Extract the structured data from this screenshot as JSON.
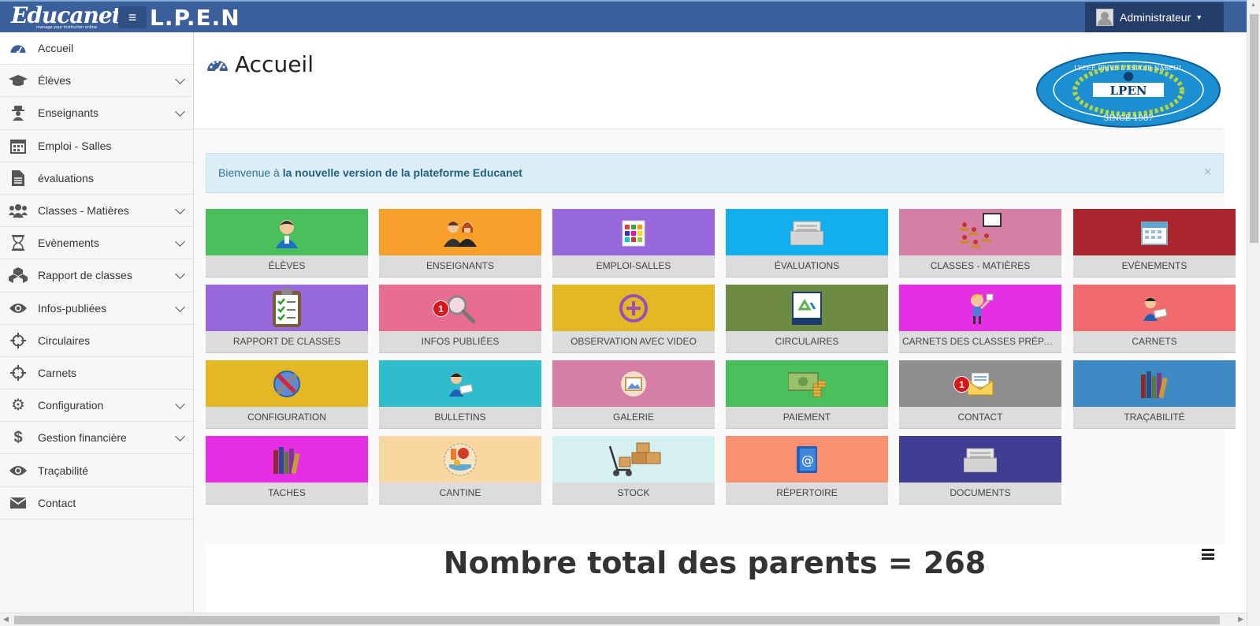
{
  "header": {
    "logo_text": "Educanet",
    "logo_tagline": "manage your institution online",
    "menu_toggle_icon": "hamburger-icon",
    "app_title": "L.P.E.N",
    "user_label": "Administrateur",
    "colors": {
      "bar": "#3a5f9a",
      "user_menu": "#243e69"
    }
  },
  "sidebar": {
    "items": [
      {
        "label": "Accueil",
        "icon": "dashboard-icon",
        "expandable": false,
        "active": true
      },
      {
        "label": "Élèves",
        "icon": "graduation-cap-icon",
        "expandable": true
      },
      {
        "label": "Enseignants",
        "icon": "user-secret-icon",
        "expandable": true
      },
      {
        "label": "Emploi - Salles",
        "icon": "calendar-icon",
        "expandable": false
      },
      {
        "label": "évaluations",
        "icon": "file-icon",
        "expandable": false
      },
      {
        "label": "Classes - Matières",
        "icon": "users-icon",
        "expandable": true
      },
      {
        "label": "Evènements",
        "icon": "hourglass-icon",
        "expandable": true
      },
      {
        "label": "Rapport de classes",
        "icon": "cubes-icon",
        "expandable": true
      },
      {
        "label": "Infos-publiées",
        "icon": "eye-icon",
        "expandable": true
      },
      {
        "label": "Circulaires",
        "icon": "crosshairs-icon",
        "expandable": false
      },
      {
        "label": "Carnets",
        "icon": "crosshairs-icon",
        "expandable": false
      },
      {
        "label": "Configuration",
        "icon": "gear-icon",
        "expandable": true
      },
      {
        "label": "Gestion financière",
        "icon": "dollar-icon",
        "expandable": true
      },
      {
        "label": "Traçabilité",
        "icon": "eye-icon",
        "expandable": false
      },
      {
        "label": "Contact",
        "icon": "envelope-icon",
        "expandable": false
      }
    ]
  },
  "page": {
    "title": "Accueil",
    "title_icon": "dashboard-icon",
    "school_logo": {
      "top_text": "LYCEE PRIVE L'ESPOIR NABEUL",
      "center_text": "LPEN",
      "bottom_text": "SINCE 1987"
    }
  },
  "alert": {
    "prefix": "Bienvenue à",
    "bold": "la nouvelle version de la plateforme Educanet",
    "close_icon": "close-icon"
  },
  "tiles": [
    {
      "label": "ÉLÈVES",
      "color": "#49bf5c",
      "icon": "student-icon"
    },
    {
      "label": "ENSEIGNANTS",
      "color": "#f6a02a",
      "icon": "teachers-icon"
    },
    {
      "label": "EMPLOI-SALLES",
      "color": "#9768dc",
      "icon": "schedule-icon"
    },
    {
      "label": "ÉVALUATIONS",
      "color": "#10aeea",
      "icon": "folder-icon"
    },
    {
      "label": "CLASSES - MATIÈRES",
      "color": "#d67fa6",
      "icon": "classroom-icon"
    },
    {
      "label": "EVÈNEMENTS",
      "color": "#a9262c",
      "icon": "calendar-icon"
    },
    {
      "label": "RAPPORT DE CLASSES",
      "color": "#9768dc",
      "icon": "clipboard-icon"
    },
    {
      "label": "INFOS PUBLIÉES",
      "color": "#e96d91",
      "icon": "magnifier-icon",
      "badge": "1"
    },
    {
      "label": "OBSERVATION AVEC VIDEO",
      "color": "#e3b824",
      "icon": "plus-circle-icon"
    },
    {
      "label": "CIRCULAIRES",
      "color": "#6e8b43",
      "icon": "recycle-icon"
    },
    {
      "label": "CARNETS DES CLASSES PRÉPARATOIRES",
      "color": "#e62fe4",
      "icon": "pupil-icon"
    },
    {
      "label": "CARNETS",
      "color": "#f06a6e",
      "icon": "reader-icon"
    },
    {
      "label": "CONFIGURATION",
      "color": "#e3b824",
      "icon": "tools-icon"
    },
    {
      "label": "BULLETINS",
      "color": "#2fbccc",
      "icon": "reader-icon"
    },
    {
      "label": "GALERIE",
      "color": "#d67fa6",
      "icon": "photo-icon"
    },
    {
      "label": "PAIEMENT",
      "color": "#49bf5c",
      "icon": "money-icon"
    },
    {
      "label": "CONTACT",
      "color": "#8e8e8e",
      "icon": "mail-icon",
      "badge": "1"
    },
    {
      "label": "TRAÇABILITÉ",
      "color": "#3d8bc2",
      "icon": "books-icon"
    },
    {
      "label": "TACHES",
      "color": "#e62fe4",
      "icon": "books-icon"
    },
    {
      "label": "CANTINE",
      "color": "#f8d7a0",
      "icon": "food-icon"
    },
    {
      "label": "STOCK",
      "color": "#d4f0f0",
      "icon": "boxes-icon"
    },
    {
      "label": "RÉPERTOIRE",
      "color": "#f79170",
      "icon": "address-book-icon"
    },
    {
      "label": "DOCUMENTS",
      "color": "#403e92",
      "icon": "folder-icon"
    }
  ],
  "stats": {
    "title": "Nombre total des parents = 268",
    "menu_icon": "hamburger-icon"
  }
}
